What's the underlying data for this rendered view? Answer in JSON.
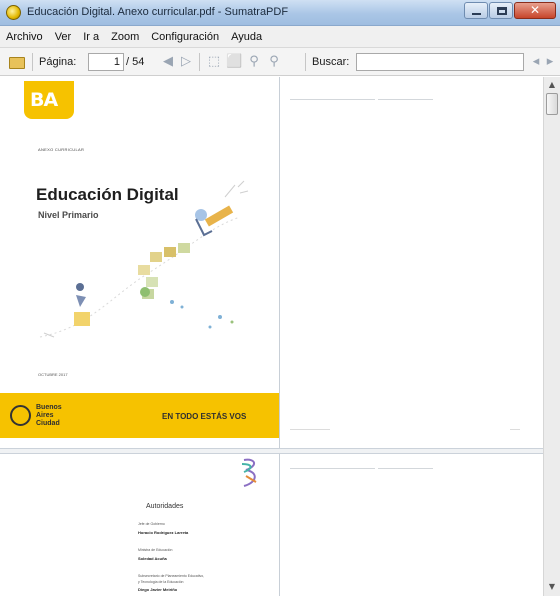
{
  "window": {
    "title": "Educación Digital. Anexo curricular.pdf - SumatraPDF"
  },
  "menu": [
    "Archivo",
    "Ver",
    "Ir a",
    "Zoom",
    "Configuración",
    "Ayuda"
  ],
  "toolbar": {
    "page_label": "Página:",
    "page_value": "1",
    "page_total": "/ 54",
    "search_label": "Buscar:",
    "search_value": ""
  },
  "page1": {
    "logo_text": "BA",
    "kicker": "ANEXO CURRICULAR",
    "title": "Educación Digital",
    "subtitle": "Nivel Primario",
    "date": "OCTUBRE 2017",
    "city_lines": [
      "Buenos",
      "Aires",
      "Ciudad"
    ],
    "slogan": "EN TODO ESTÁS VOS"
  },
  "page3": {
    "title": "Autoridades",
    "roles": [
      "Jefe de Gobierno",
      "Ministra de Educación",
      "Subsecretario de Planeamiento Educativo,",
      "y Tecnología de la Educación"
    ],
    "names": [
      "Horacio Rodríguez Larreta",
      "Soledad Acuña",
      "Diego Javier Meiriño"
    ]
  },
  "colors": {
    "brand_yellow": "#f6c200",
    "title_bar": "#aac6e6"
  }
}
